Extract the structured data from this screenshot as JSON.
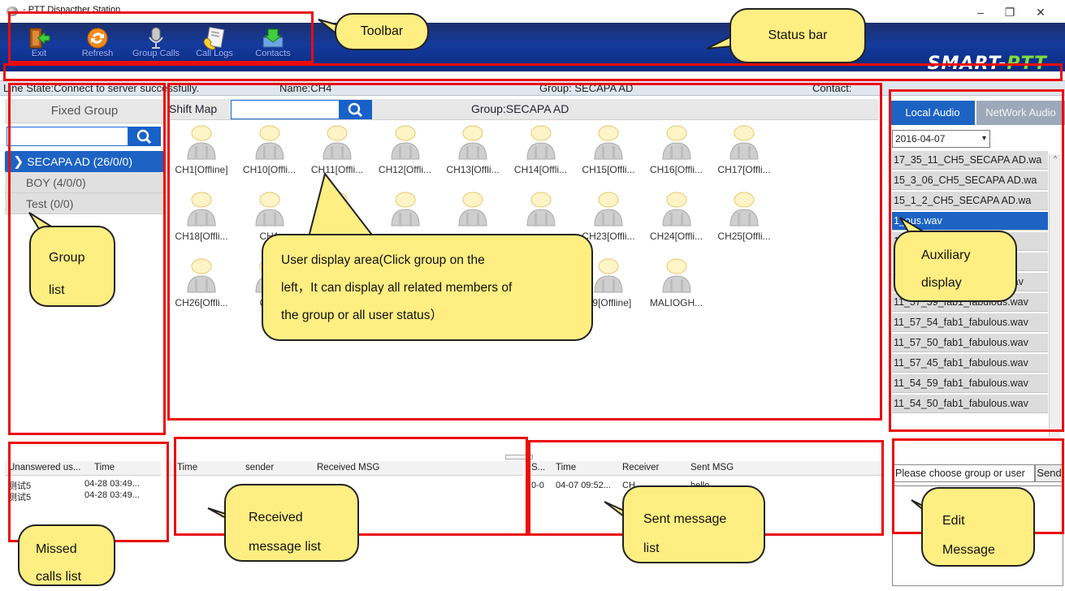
{
  "window": {
    "title": " - PTT Dispacther Station",
    "minimize": "–",
    "restore": "❐",
    "close": "✕"
  },
  "toolbar": {
    "items": [
      {
        "label": "Exit",
        "icon": "exit-icon"
      },
      {
        "label": "Refresh",
        "icon": "refresh-icon"
      },
      {
        "label": "Group Calls",
        "icon": "microphone-icon"
      },
      {
        "label": "Call Logs",
        "icon": "call-logs-icon"
      },
      {
        "label": "Contacts",
        "icon": "contacts-icon"
      }
    ],
    "brand_main": "SMART-",
    "brand_accent": "PTT"
  },
  "line_state": {
    "state": "Line State:Connect to server successfully.",
    "name": "Name:CH4",
    "group": "Group: SECAPA AD",
    "contact": "Contact:"
  },
  "left_panel": {
    "tab": "Fixed Group",
    "groups": [
      {
        "label": "SECAPA AD (26/0/0)",
        "selected": true
      },
      {
        "label": "BOY (4/0/0)",
        "selected": false
      },
      {
        "label": "Test (0/0)",
        "selected": false
      }
    ]
  },
  "map_bar": {
    "shift_map": "Shift Map",
    "group_label": "Group:SECAPA AD"
  },
  "members": [
    "CH1[Offline]",
    "CH10[Offli...",
    "CH11[Offli...",
    "CH12[Offli...",
    "CH13[Offli...",
    "CH14[Offli...",
    "CH15[Offli...",
    "CH16[Offli...",
    "CH17[Offli...",
    "CH18[Offli...",
    "CH1",
    "",
    "",
    "",
    "",
    "CH23[Offli...",
    "CH24[Offli...",
    "CH25[Offli...",
    "CH26[Offli...",
    "CH3",
    "",
    "",
    "",
    "",
    "H9[Offline]",
    "MALIOGH..."
  ],
  "audio": {
    "tab_local": "Local Audio",
    "tab_network": "NetWork Audio",
    "date": "2016-04-07",
    "files": [
      "17_35_11_CH5_SECAPA AD.wa",
      "15_3_06_CH5_SECAPA AD.wa",
      "15_1_2_CH5_SECAPA AD.wa",
      "1_ous.wav",
      "1_us.wav",
      "1_us.wav",
      "12_0_59_fab1_fabulous.wav",
      "11_57_59_fab1_fabulous.wav",
      "11_57_54_fab1_fabulous.wav",
      "11_57_50_fab1_fabulous.wav",
      "11_57_45_fab1_fabulous.wav",
      "11_54_59_fab1_fabulous.wav",
      "11_54_50_fab1_fabulous.wav"
    ]
  },
  "missed_calls": {
    "headers": [
      "Unanswered us...",
      "Time"
    ],
    "rows": [
      [
        "测试5",
        "04-28 03:49..."
      ],
      [
        "测试5",
        "04-28 03:49..."
      ]
    ]
  },
  "received": {
    "headers": [
      "Time",
      "sender",
      "Received MSG"
    ]
  },
  "sent": {
    "headers": [
      "S...",
      "Time",
      "Receiver",
      "Sent MSG"
    ],
    "rows": [
      [
        "0-0",
        "04-07 09:52...",
        "CH",
        "hello"
      ]
    ]
  },
  "edit": {
    "placeholder": "Please choose group or user",
    "send": "Send"
  },
  "annotations": {
    "toolbar": "Toolbar",
    "status_bar": "Status bar",
    "group_list_1": "Group",
    "group_list_2": "list",
    "user_area_1": "User  display  area(Click  group  on  the",
    "user_area_2": "left，It can display all related members of",
    "user_area_3": "the group or all user status）",
    "auxiliary_1": "Auxiliary",
    "auxiliary_2": "display",
    "missed_1": "Missed",
    "missed_2": "calls list",
    "received_1": "Received",
    "received_2": "message list",
    "sent_1": "Sent  message",
    "sent_2": "list",
    "edit_1": "Edit",
    "edit_2": "Message"
  },
  "colors": {
    "toolbar_blue": "#143a9c",
    "selected_blue": "#1c63c4",
    "highlight_red": "#ea0c0c",
    "callout_yellow": "#ffee82"
  }
}
